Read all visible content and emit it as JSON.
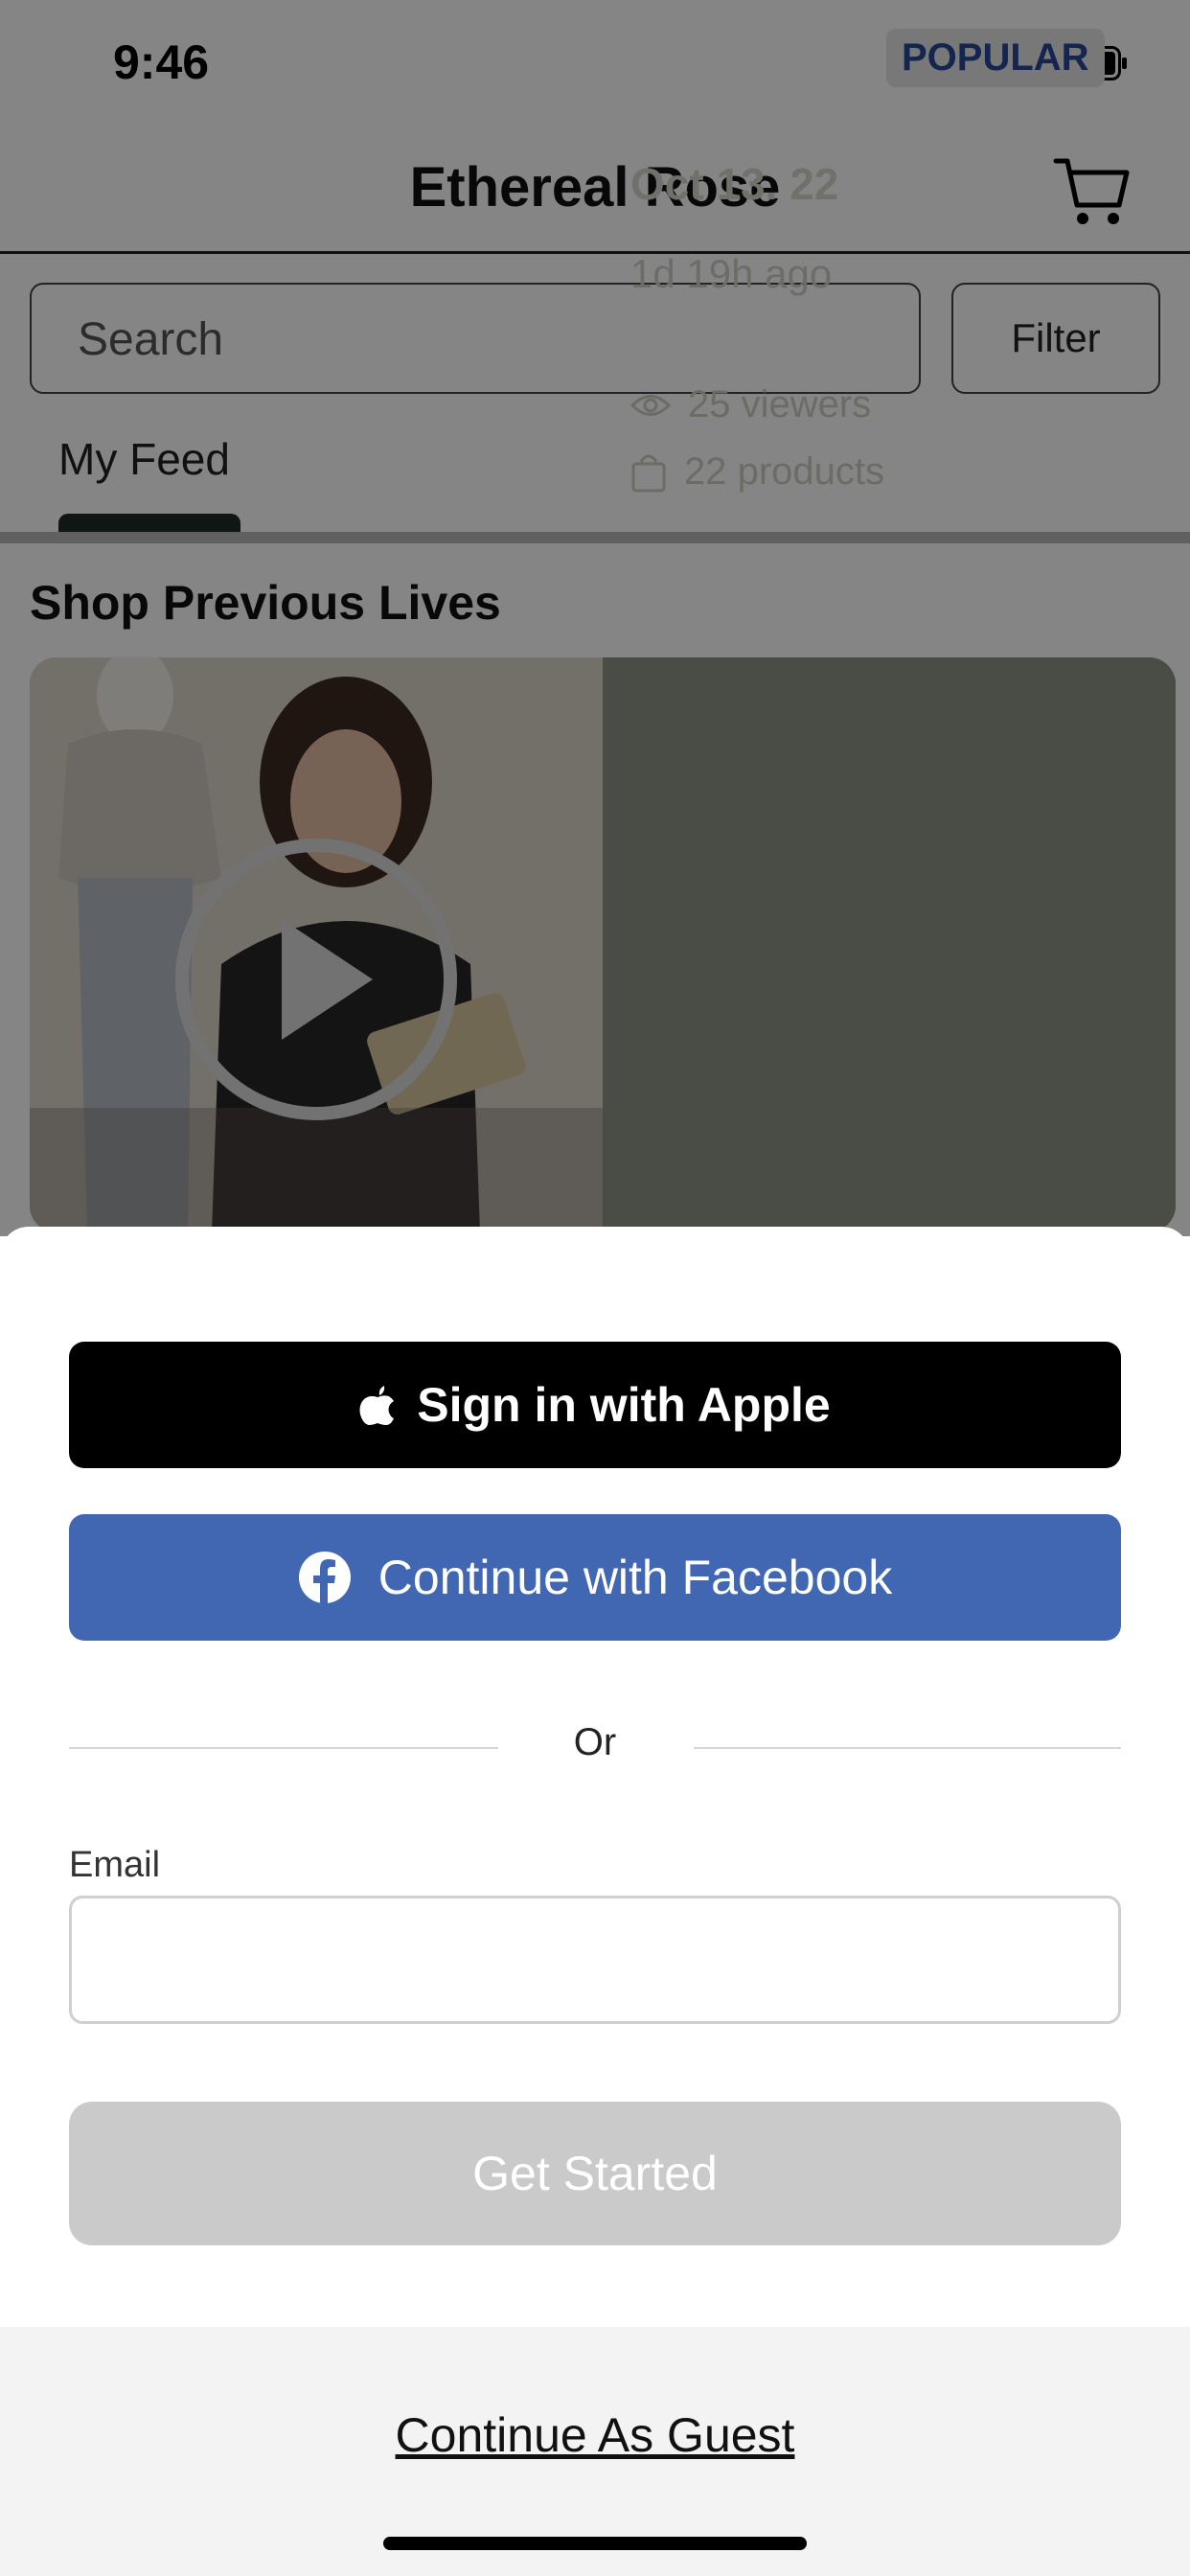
{
  "status_bar": {
    "time": "9:46"
  },
  "header": {
    "title": "Ethereal Rose"
  },
  "search": {
    "placeholder": "Search",
    "filter_label": "Filter"
  },
  "tabs": [
    {
      "label": "My Feed",
      "active": true
    }
  ],
  "section": {
    "title": "Shop Previous Lives"
  },
  "live_card": {
    "badge": "POPULAR",
    "date": "Oct 13. 22",
    "ago": "1d 19h ago",
    "viewers": "25 viewers",
    "products": "22 products"
  },
  "login_sheet": {
    "apple_label": "Sign in with Apple",
    "facebook_label": "Continue with Facebook",
    "or_label": "Or",
    "email_label": "Email",
    "email_value": "",
    "get_started_label": "Get Started",
    "guest_label": "Continue As Guest"
  },
  "colors": {
    "facebook": "#4267b2",
    "apple": "#000000",
    "disabled": "#cacaca",
    "badge_text": "#27489a"
  },
  "icons": [
    "wifi-icon",
    "battery-icon",
    "cart-icon",
    "play-icon",
    "eye-icon",
    "bag-icon",
    "apple-icon",
    "facebook-icon"
  ]
}
